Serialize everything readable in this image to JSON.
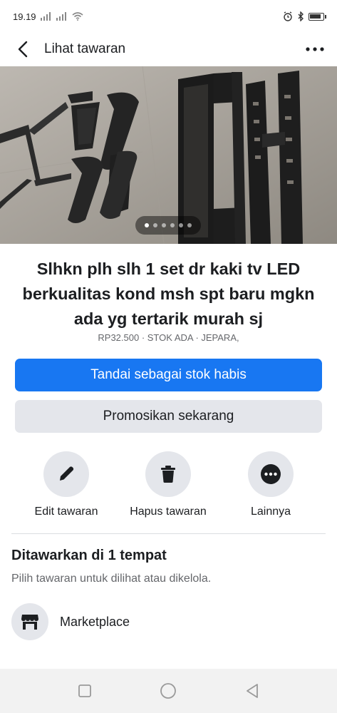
{
  "status_bar": {
    "time": "19.19",
    "icons": [
      "sim1-signal-icon",
      "sim2-signal-icon",
      "wifi-icon",
      "alarm-icon",
      "bluetooth-icon",
      "battery-icon"
    ]
  },
  "header": {
    "title": "Lihat tawaran",
    "back_icon": "back-arrow-icon",
    "more_icon": "more-dots-icon"
  },
  "listing": {
    "photo_count": 6,
    "active_photo_index": 0,
    "title": "Slhkn plh slh 1 set dr kaki tv LED berkualitas kond msh spt baru mgkn ada yg tertarik murah sj",
    "meta": "RP32.500 · STOK ADA · JEPARA,"
  },
  "buttons": {
    "primary": "Tandai sebagai stok habis",
    "secondary": "Promosikan sekarang",
    "primary_color": "#1877f2",
    "secondary_color": "#e4e6eb"
  },
  "actions": [
    {
      "label": "Edit tawaran",
      "icon": "pencil-icon"
    },
    {
      "label": "Hapus tawaran",
      "icon": "trash-icon"
    },
    {
      "label": "Lainnya",
      "icon": "more-circle-icon"
    }
  ],
  "offered": {
    "title": "Ditawarkan di 1 tempat",
    "subtitle": "Pilih tawaran untuk dilihat atau dikelola.",
    "places": [
      {
        "label": "Marketplace",
        "icon": "storefront-icon"
      }
    ]
  },
  "nav": {
    "icons": [
      "recent-apps-icon",
      "home-icon",
      "back-icon"
    ]
  }
}
